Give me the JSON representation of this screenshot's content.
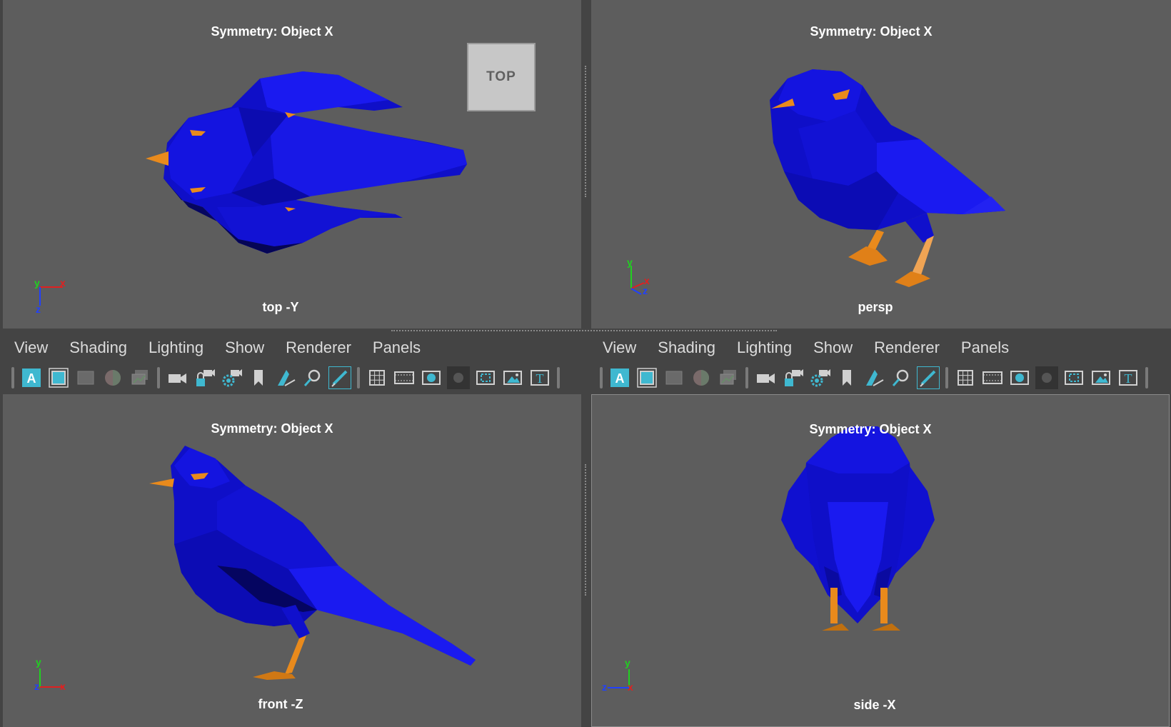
{
  "viewports": [
    {
      "id": "top",
      "symmetry": "Symmetry: Object X",
      "camera": "top -Y",
      "axes": {
        "a": "y",
        "b": "x",
        "c": "z"
      },
      "viewcube": "TOP"
    },
    {
      "id": "persp",
      "symmetry": "Symmetry: Object X",
      "camera": "persp",
      "axes": {
        "a": "y",
        "b": "x",
        "c": "z"
      }
    },
    {
      "id": "front",
      "symmetry": "Symmetry: Object X",
      "camera": "front -Z",
      "axes": {
        "a": "y",
        "b": "x",
        "c": "z"
      }
    },
    {
      "id": "side",
      "symmetry": "Symmetry: Object X",
      "camera": "side -X",
      "axes": {
        "a": "y",
        "b": "x",
        "c": "z"
      }
    }
  ],
  "panel_menu": [
    "View",
    "Shading",
    "Lighting",
    "Show",
    "Renderer",
    "Panels"
  ],
  "toolbar_icons": [
    "select-camera-icon",
    "camera-attributes-icon",
    "bookmarks-icon",
    "image-plane-icon",
    "grease-pencil-icon",
    "camera-icon",
    "lock-camera-icon",
    "camera-settings-icon",
    "bookmark-icon",
    "2d-pan-zoom-icon",
    "zoom-icon",
    "grease-pencil-tool-icon",
    "grid-icon",
    "film-gate-icon",
    "resolution-gate-icon",
    "gate-mask-icon",
    "field-chart-icon",
    "safe-action-icon",
    "safe-title-icon"
  ],
  "colors": {
    "viewport_bg": "#5d5d5d",
    "ui_bg": "#444444",
    "bird_blue": "#1010d0",
    "beak_orange": "#e98a1c",
    "text": "#ffffff",
    "axis_x": "#e02020",
    "axis_y": "#20d020",
    "axis_z": "#2040ff",
    "icon_accent": "#3fb8d0"
  }
}
